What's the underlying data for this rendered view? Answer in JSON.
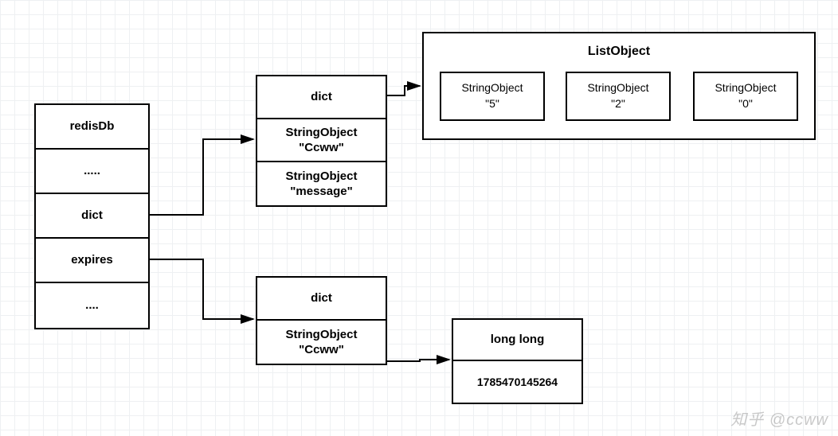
{
  "redisDb": {
    "rows": [
      "redisDb",
      ".....",
      "dict",
      "expires",
      "...."
    ]
  },
  "dict1": {
    "rows": [
      {
        "line1": "dict",
        "line2": ""
      },
      {
        "line1": "StringObject",
        "line2": "\"Ccww\""
      },
      {
        "line1": "StringObject",
        "line2": "\"message\""
      }
    ]
  },
  "dict2": {
    "rows": [
      {
        "line1": "dict",
        "line2": ""
      },
      {
        "line1": "StringObject",
        "line2": "\"Ccww\""
      }
    ]
  },
  "listObject": {
    "title": "ListObject",
    "items": [
      {
        "line1": "StringObject",
        "line2": "\"5\""
      },
      {
        "line1": "StringObject",
        "line2": "\"2\""
      },
      {
        "line1": "StringObject",
        "line2": "\"0\""
      }
    ]
  },
  "longLong": {
    "label": "long long",
    "value": "1785470145264"
  },
  "watermark": "知乎 @ccww"
}
